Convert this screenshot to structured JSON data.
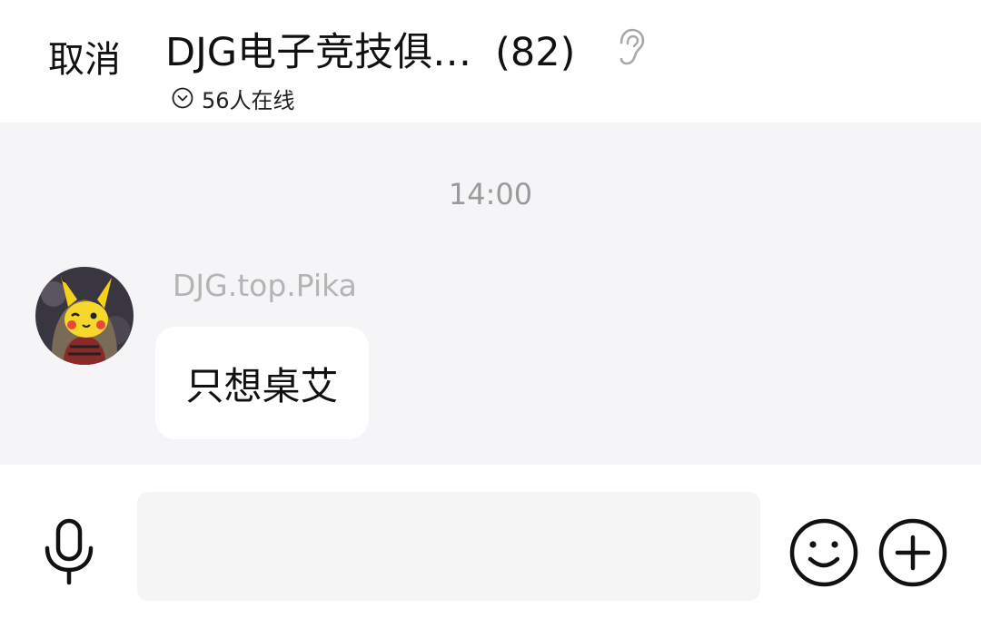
{
  "header": {
    "cancel_label": "取消",
    "group_name": "DJG电子竞技俱…",
    "member_count": "(82)",
    "online_text": "56人在线"
  },
  "chat": {
    "timestamp": "14:00",
    "messages": [
      {
        "sender": "DJG.top.Pika",
        "text": "只想桌艾",
        "avatar": "pikachu-avatar"
      }
    ]
  },
  "input": {
    "placeholder": "",
    "value": ""
  },
  "icons": {
    "ear": "ear-icon",
    "online_toggle": "chevron-down-circle-icon",
    "voice": "microphone-icon",
    "emoji": "smiley-icon",
    "more": "plus-circle-icon"
  },
  "colors": {
    "chat_background": "#f5f4f6",
    "bubble": "#ffffff",
    "sender_name": "#b4b4b4",
    "timestamp": "#9a9a9a"
  }
}
